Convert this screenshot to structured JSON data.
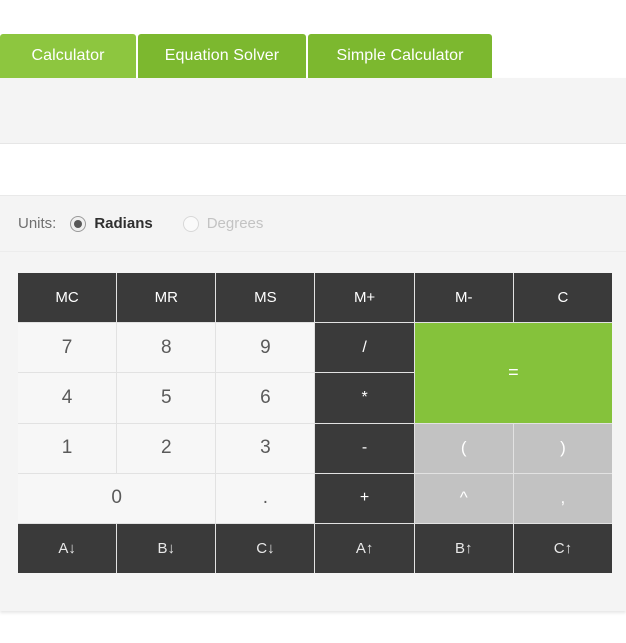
{
  "tabs": [
    {
      "label": "Calculator",
      "active": true
    },
    {
      "label": "Equation Solver",
      "active": false
    },
    {
      "label": "Simple Calculator",
      "active": false
    }
  ],
  "display": {
    "value": "",
    "placeholder": ""
  },
  "units": {
    "label": "Units:",
    "options": [
      {
        "label": "Radians",
        "selected": true,
        "disabled": false
      },
      {
        "label": "Degrees",
        "selected": false,
        "disabled": true
      }
    ]
  },
  "keypad": {
    "rows": [
      [
        {
          "label": "MC",
          "style": "dark"
        },
        {
          "label": "MR",
          "style": "dark"
        },
        {
          "label": "MS",
          "style": "dark"
        },
        {
          "label": "M+",
          "style": "dark"
        },
        {
          "label": "M-",
          "style": "dark"
        },
        {
          "label": "C",
          "style": "dark"
        }
      ],
      [
        {
          "label": "7",
          "style": "num"
        },
        {
          "label": "8",
          "style": "num"
        },
        {
          "label": "9",
          "style": "num"
        },
        {
          "label": "/",
          "style": "op"
        },
        {
          "label": "=",
          "style": "equals"
        }
      ],
      [
        {
          "label": "4",
          "style": "num"
        },
        {
          "label": "5",
          "style": "num"
        },
        {
          "label": "6",
          "style": "num"
        },
        {
          "label": "*",
          "style": "op"
        }
      ],
      [
        {
          "label": "1",
          "style": "num"
        },
        {
          "label": "2",
          "style": "num"
        },
        {
          "label": "3",
          "style": "num"
        },
        {
          "label": "-",
          "style": "op"
        },
        {
          "label": "(",
          "style": "disabled"
        },
        {
          "label": ")",
          "style": "disabled"
        }
      ],
      [
        {
          "label": "0",
          "style": "num wide2"
        },
        {
          "label": ".",
          "style": "num"
        },
        {
          "label": "+",
          "style": "op"
        },
        {
          "label": "^",
          "style": "disabled"
        },
        {
          "label": ",",
          "style": "disabled"
        }
      ],
      [
        {
          "label": "A↓",
          "style": "var"
        },
        {
          "label": "B↓",
          "style": "var"
        },
        {
          "label": "C↓",
          "style": "var"
        },
        {
          "label": "A↑",
          "style": "var"
        },
        {
          "label": "B↑",
          "style": "var"
        },
        {
          "label": "C↑",
          "style": "var"
        }
      ]
    ]
  },
  "colors": {
    "accent_green": "#85c23b",
    "tab_active": "#8dc63f",
    "tab_inactive": "#7cb82f",
    "key_dark": "#3a3a3a",
    "key_disabled": "#c2c2c2",
    "key_light": "#f7f7f7",
    "panel_bg": "#f4f4f4"
  }
}
